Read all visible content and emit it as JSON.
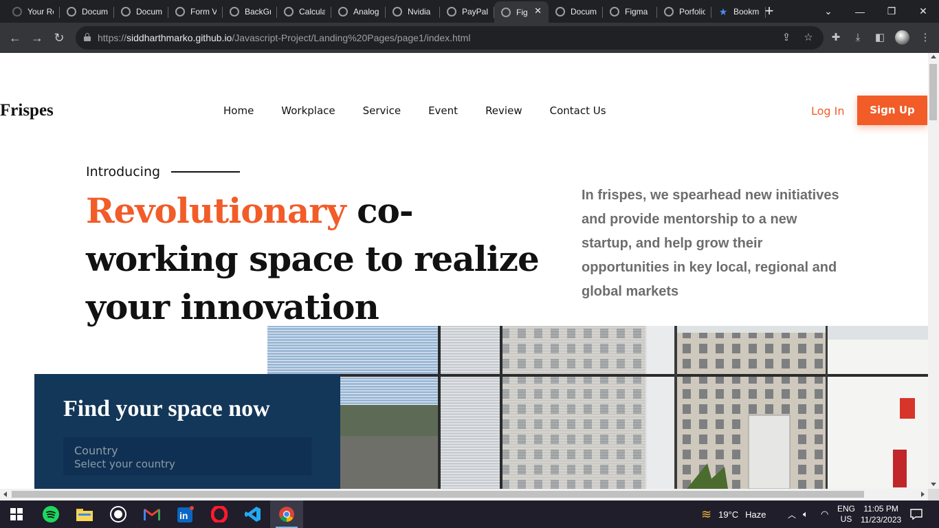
{
  "browser": {
    "tabs": [
      {
        "label": "Your Re",
        "icon": "github-icon"
      },
      {
        "label": "Docum",
        "icon": "globe-icon"
      },
      {
        "label": "Docum",
        "icon": "globe-icon"
      },
      {
        "label": "Form V",
        "icon": "globe-icon"
      },
      {
        "label": "BackGr",
        "icon": "globe-icon"
      },
      {
        "label": "Calcula",
        "icon": "globe-icon"
      },
      {
        "label": "Analog",
        "icon": "globe-icon"
      },
      {
        "label": "Nvidia",
        "icon": "globe-icon"
      },
      {
        "label": "PayPal",
        "icon": "globe-icon"
      },
      {
        "label": "Fig",
        "icon": "globe-icon",
        "active": true
      },
      {
        "label": "Docum",
        "icon": "globe-icon"
      },
      {
        "label": "Figma",
        "icon": "globe-icon"
      },
      {
        "label": "Porfolio",
        "icon": "globe-icon"
      },
      {
        "label": "Bookm",
        "icon": "star-icon"
      }
    ],
    "url_prefix": "https://",
    "url_host": "siddharthmarko.github.io",
    "url_path": "/Javascript-Project/Landing%20Pages/page1/index.html"
  },
  "site": {
    "logo": "Frispes",
    "nav": [
      "Home",
      "Workplace",
      "Service",
      "Event",
      "Review",
      "Contact Us"
    ],
    "login": "Log In",
    "signup": "Sign Up",
    "intro": "Introducing",
    "headline_accent": "Revolutionary",
    "headline_rest": " co-working space to realize your innovation",
    "lead": "In frispes, we spearhead new initiatives and provide mentorship to a new startup, and help grow their opportunities in key local, regional and global markets",
    "find": {
      "title": "Find your space now",
      "country_label": "Country",
      "country_placeholder": "Select your country"
    },
    "accent_color": "#f25c28",
    "panel_color": "#133759"
  },
  "taskbar": {
    "weather_temp": "19°C",
    "weather_text": "Haze",
    "lang_top": "ENG",
    "lang_bottom": "US",
    "time": "11:05 PM",
    "date": "11/23/2023"
  }
}
